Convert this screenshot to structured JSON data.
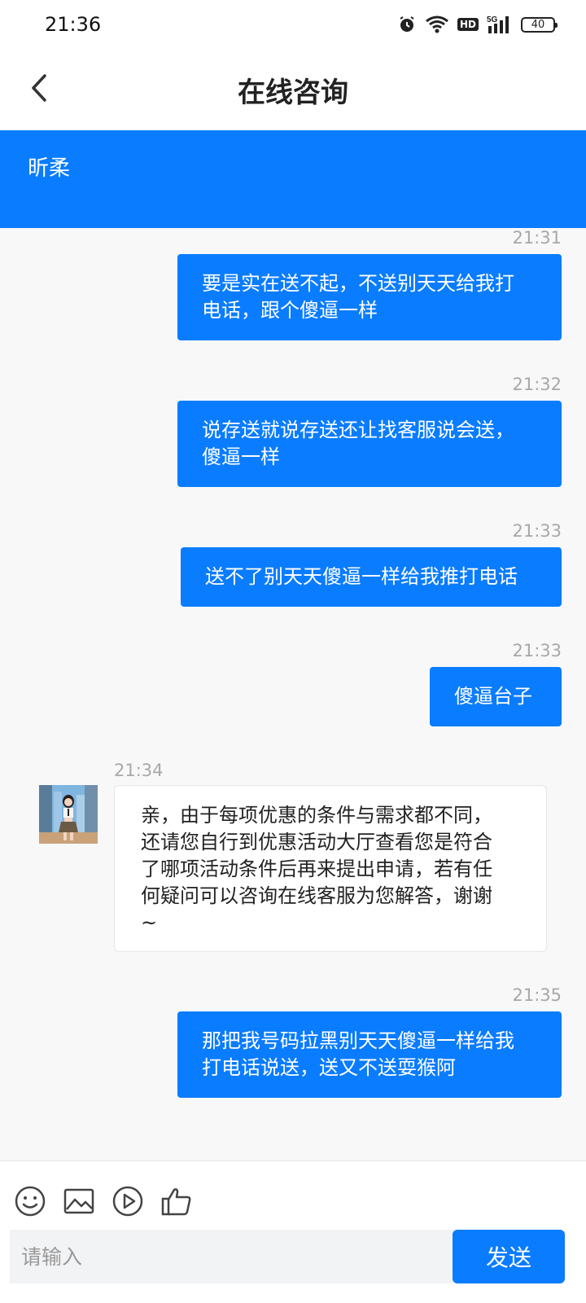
{
  "status_bar": {
    "time": "21:36",
    "battery": "40",
    "network": "5G",
    "hd_label": "HD",
    "icons": [
      "alarm-icon",
      "wifi-icon",
      "hd-icon",
      "signal-icon",
      "battery-icon"
    ]
  },
  "header": {
    "title": "在线咨询",
    "back_icon": "chevron-left-icon"
  },
  "agent": {
    "name": "昕柔"
  },
  "messages": [
    {
      "side": "out",
      "time": "21:31",
      "lines": [
        "要是实在送不起，不送别天天给我打",
        "电话，跟个傻逼一样"
      ]
    },
    {
      "side": "out",
      "time": "21:32",
      "lines": [
        "说存送就说存送还让找客服说会送，",
        "傻逼一样"
      ]
    },
    {
      "side": "out",
      "time": "21:33",
      "lines": [
        "送不了别天天傻逼一样给我推打电话"
      ]
    },
    {
      "side": "out",
      "time": "21:33",
      "lines": [
        "傻逼台子"
      ]
    },
    {
      "side": "in",
      "time": "21:34",
      "lines": [
        "亲，由于每项优惠的条件与需求都不同，",
        "还请您自行到优惠活动大厅查看您是符合",
        "了哪项活动条件后再来提出申请，若有任",
        "何疑问可以咨询在线客服为您解答，谢谢",
        "~"
      ]
    },
    {
      "side": "out",
      "time": "21:35",
      "lines": [
        "那把我号码拉黑别天天傻逼一样给我",
        "打电话说送，送又不送耍猴阿"
      ]
    }
  ],
  "toolbar": {
    "icons": [
      "emoji-icon",
      "image-icon",
      "video-icon",
      "thumbs-up-icon"
    ]
  },
  "input": {
    "placeholder": "请输入",
    "value": ""
  },
  "send_label": "发送",
  "colors": {
    "accent": "#0a7cff",
    "chat_bg": "#f8f8f9",
    "time_text": "#a8a8a8"
  }
}
